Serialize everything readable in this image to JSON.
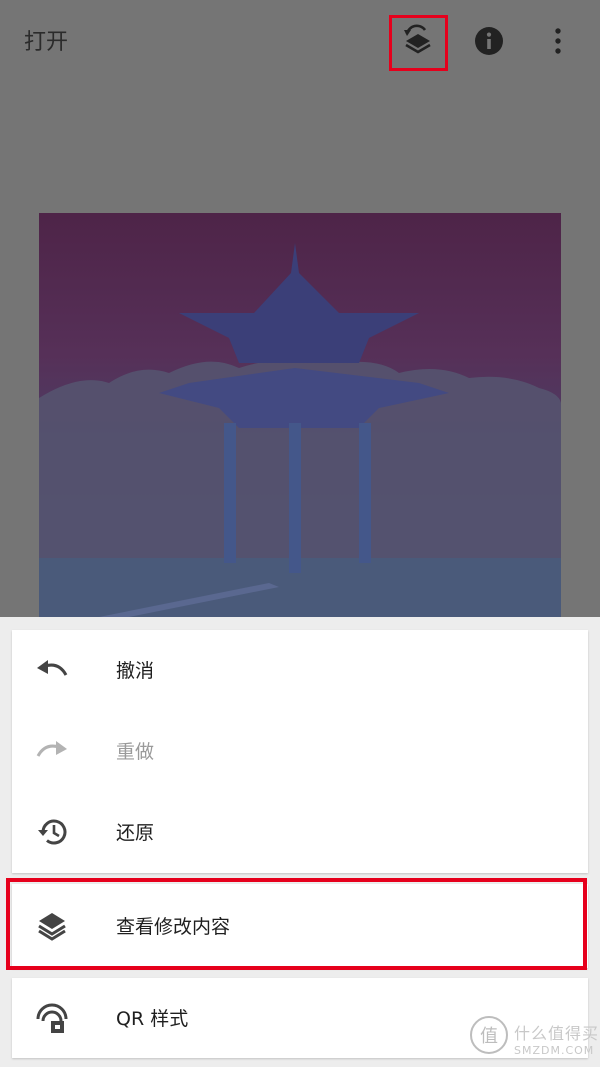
{
  "topbar": {
    "open_label": "打开",
    "icons": [
      "layers-history-icon",
      "info-icon",
      "more-vert-icon"
    ]
  },
  "menu": {
    "items": [
      {
        "label": "撤消",
        "icon": "undo-icon",
        "enabled": true
      },
      {
        "label": "重做",
        "icon": "redo-icon",
        "enabled": false
      },
      {
        "label": "还原",
        "icon": "history-icon",
        "enabled": true
      }
    ],
    "view_changes": {
      "label": "查看修改内容",
      "icon": "layers-icon"
    },
    "qr_style": {
      "label": "QR 样式",
      "icon": "qr-style-icon"
    }
  },
  "watermark": {
    "title": "什么值得买",
    "subtitle": "SMZDM.COM",
    "logo_text": "值"
  },
  "colors": {
    "highlight": "#e6001c",
    "background_dim": "#757575"
  }
}
